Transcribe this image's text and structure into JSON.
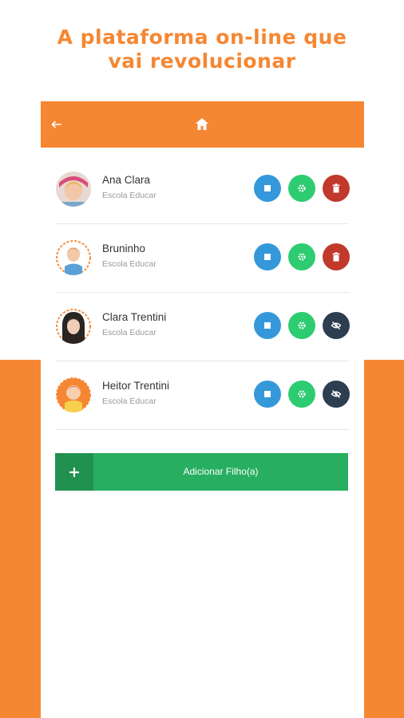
{
  "headline": {
    "line1": "A plataforma on-line que",
    "line2": "vai revolucionar"
  },
  "colors": {
    "brand_orange": "#f58733",
    "stop_blue": "#3498db",
    "settings_green": "#2ecc71",
    "delete_red": "#c0392b",
    "hide_dark": "#2c3e50",
    "add_green": "#27ae60"
  },
  "appbar": {
    "back_icon": "arrow-left-icon",
    "home_icon": "home-icon"
  },
  "children": [
    {
      "name": "Ana Clara",
      "school": "Escola Educar",
      "third_action": "trash-icon"
    },
    {
      "name": "Bruninho",
      "school": "Escola Educar",
      "third_action": "trash-icon"
    },
    {
      "name": "Clara Trentini",
      "school": "Escola Educar",
      "third_action": "eye-slash-icon"
    },
    {
      "name": "Heitor Trentini",
      "school": "Escola Educar",
      "third_action": "eye-slash-icon"
    }
  ],
  "add_button": {
    "icon": "plus",
    "label": "Adicionar Filho(a)"
  }
}
